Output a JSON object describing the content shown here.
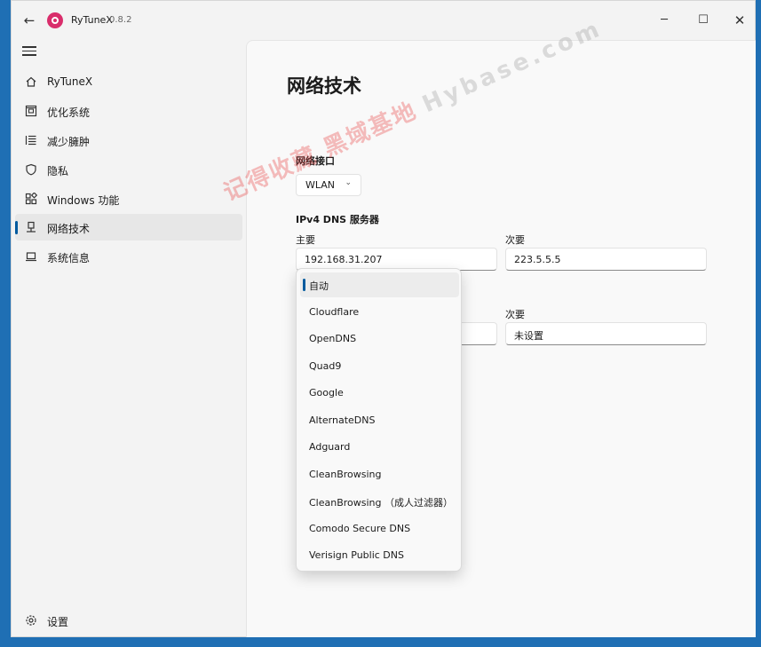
{
  "titlebar": {
    "back_glyph": "←",
    "app_name": "RyTuneX",
    "version": "0.8.2",
    "minimize_glyph": "─",
    "maximize_glyph": "☐",
    "close_glyph": "✕"
  },
  "sidebar": {
    "items": [
      {
        "label": "RyTuneX",
        "icon": "home-icon"
      },
      {
        "label": "优化系统",
        "icon": "optimize-icon"
      },
      {
        "label": "减少臃肿",
        "icon": "debloat-list-icon"
      },
      {
        "label": "隐私",
        "icon": "shield-icon"
      },
      {
        "label": "Windows 功能",
        "icon": "windows-features-icon"
      },
      {
        "label": "网络技术",
        "icon": "network-icon",
        "selected": true
      },
      {
        "label": "系统信息",
        "icon": "laptop-icon"
      }
    ],
    "settings": {
      "label": "设置",
      "icon": "gear-icon"
    }
  },
  "main": {
    "title": "网络技术",
    "interface_label": "网络接口",
    "interface_value": "WLAN",
    "ipv4_label": "IPv4 DNS 服务器",
    "primary_label": "主要",
    "primary_value": "192.168.31.207",
    "secondary_label": "次要",
    "secondary_value": "223.5.5.5",
    "secondary2_label": "次要",
    "secondary2_value": "未设置"
  },
  "dropdown": {
    "options": [
      {
        "label": "自动",
        "selected": true
      },
      {
        "label": "Cloudflare"
      },
      {
        "label": "OpenDNS"
      },
      {
        "label": "Quad9"
      },
      {
        "label": "Google"
      },
      {
        "label": "AlternateDNS"
      },
      {
        "label": "Adguard"
      },
      {
        "label": "CleanBrowsing"
      },
      {
        "label": "CleanBrowsing （成人过滤器）"
      },
      {
        "label": "Comodo Secure DNS"
      },
      {
        "label": "Verisign Public DNS"
      }
    ]
  },
  "watermark": {
    "cn": "记得收藏 黑域基地",
    "en": "Hybase.com"
  },
  "colors": {
    "accent": "#005a9e",
    "desktop": "#1f6fb4",
    "watermark": "#e84646"
  }
}
